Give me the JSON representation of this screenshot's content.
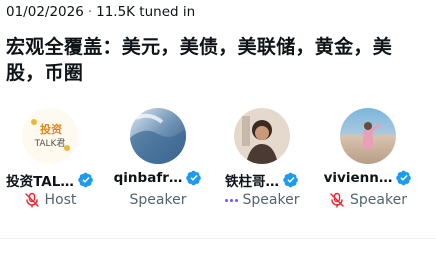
{
  "space": {
    "date": "01/02/2026",
    "separator": "·",
    "tuned_in": "11.5K tuned in",
    "title": "宏观全覆盖：美元，美债，美联储，黄金，美股，币圈"
  },
  "speakers": [
    {
      "name": "投资TAL…",
      "role": "Host",
      "role_icon": "microphone-off-icon",
      "avatar_text": "投资\nTALK君"
    },
    {
      "name": "qinbafr…",
      "role": "Speaker",
      "role_icon": ""
    },
    {
      "name": "铁柱哥…",
      "role": "Speaker",
      "role_icon": "speaking-dots-icon"
    },
    {
      "name": "vivienn…",
      "role": "Speaker",
      "role_icon": "microphone-off-icon"
    }
  ],
  "colors": {
    "verified": "#1d9bf0",
    "muted_mic": "#f4212e",
    "speaking_dots": "#7856ff",
    "secondary_text": "#536471"
  }
}
